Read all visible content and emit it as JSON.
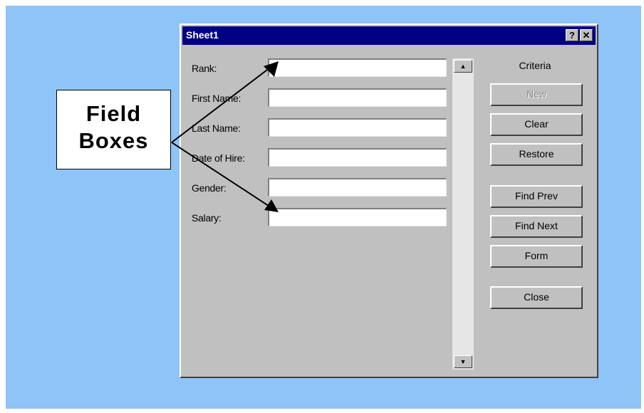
{
  "dialog": {
    "title": "Sheet1",
    "help_glyph": "?",
    "close_glyph": "✕"
  },
  "fields": [
    {
      "label": "Rank:",
      "value": ""
    },
    {
      "label": "First Name:",
      "value": ""
    },
    {
      "label": "Last Name:",
      "value": ""
    },
    {
      "label": "Date of Hire:",
      "value": ""
    },
    {
      "label": "Gender:",
      "value": ""
    },
    {
      "label": "Salary:",
      "value": ""
    }
  ],
  "criteria_label": "Criteria",
  "buttons": {
    "new": "New",
    "clear": "Clear",
    "restore": "Restore",
    "find_prev": "Find Prev",
    "find_next": "Find Next",
    "form": "Form",
    "close": "Close"
  },
  "scrollbar": {
    "up_glyph": "▲",
    "down_glyph": "▼"
  },
  "callout": {
    "line1": "Field",
    "line2": "Boxes"
  },
  "colors": {
    "backdrop": "#8ec4f7",
    "titlebar": "#000082",
    "face": "#c0c0c0"
  }
}
